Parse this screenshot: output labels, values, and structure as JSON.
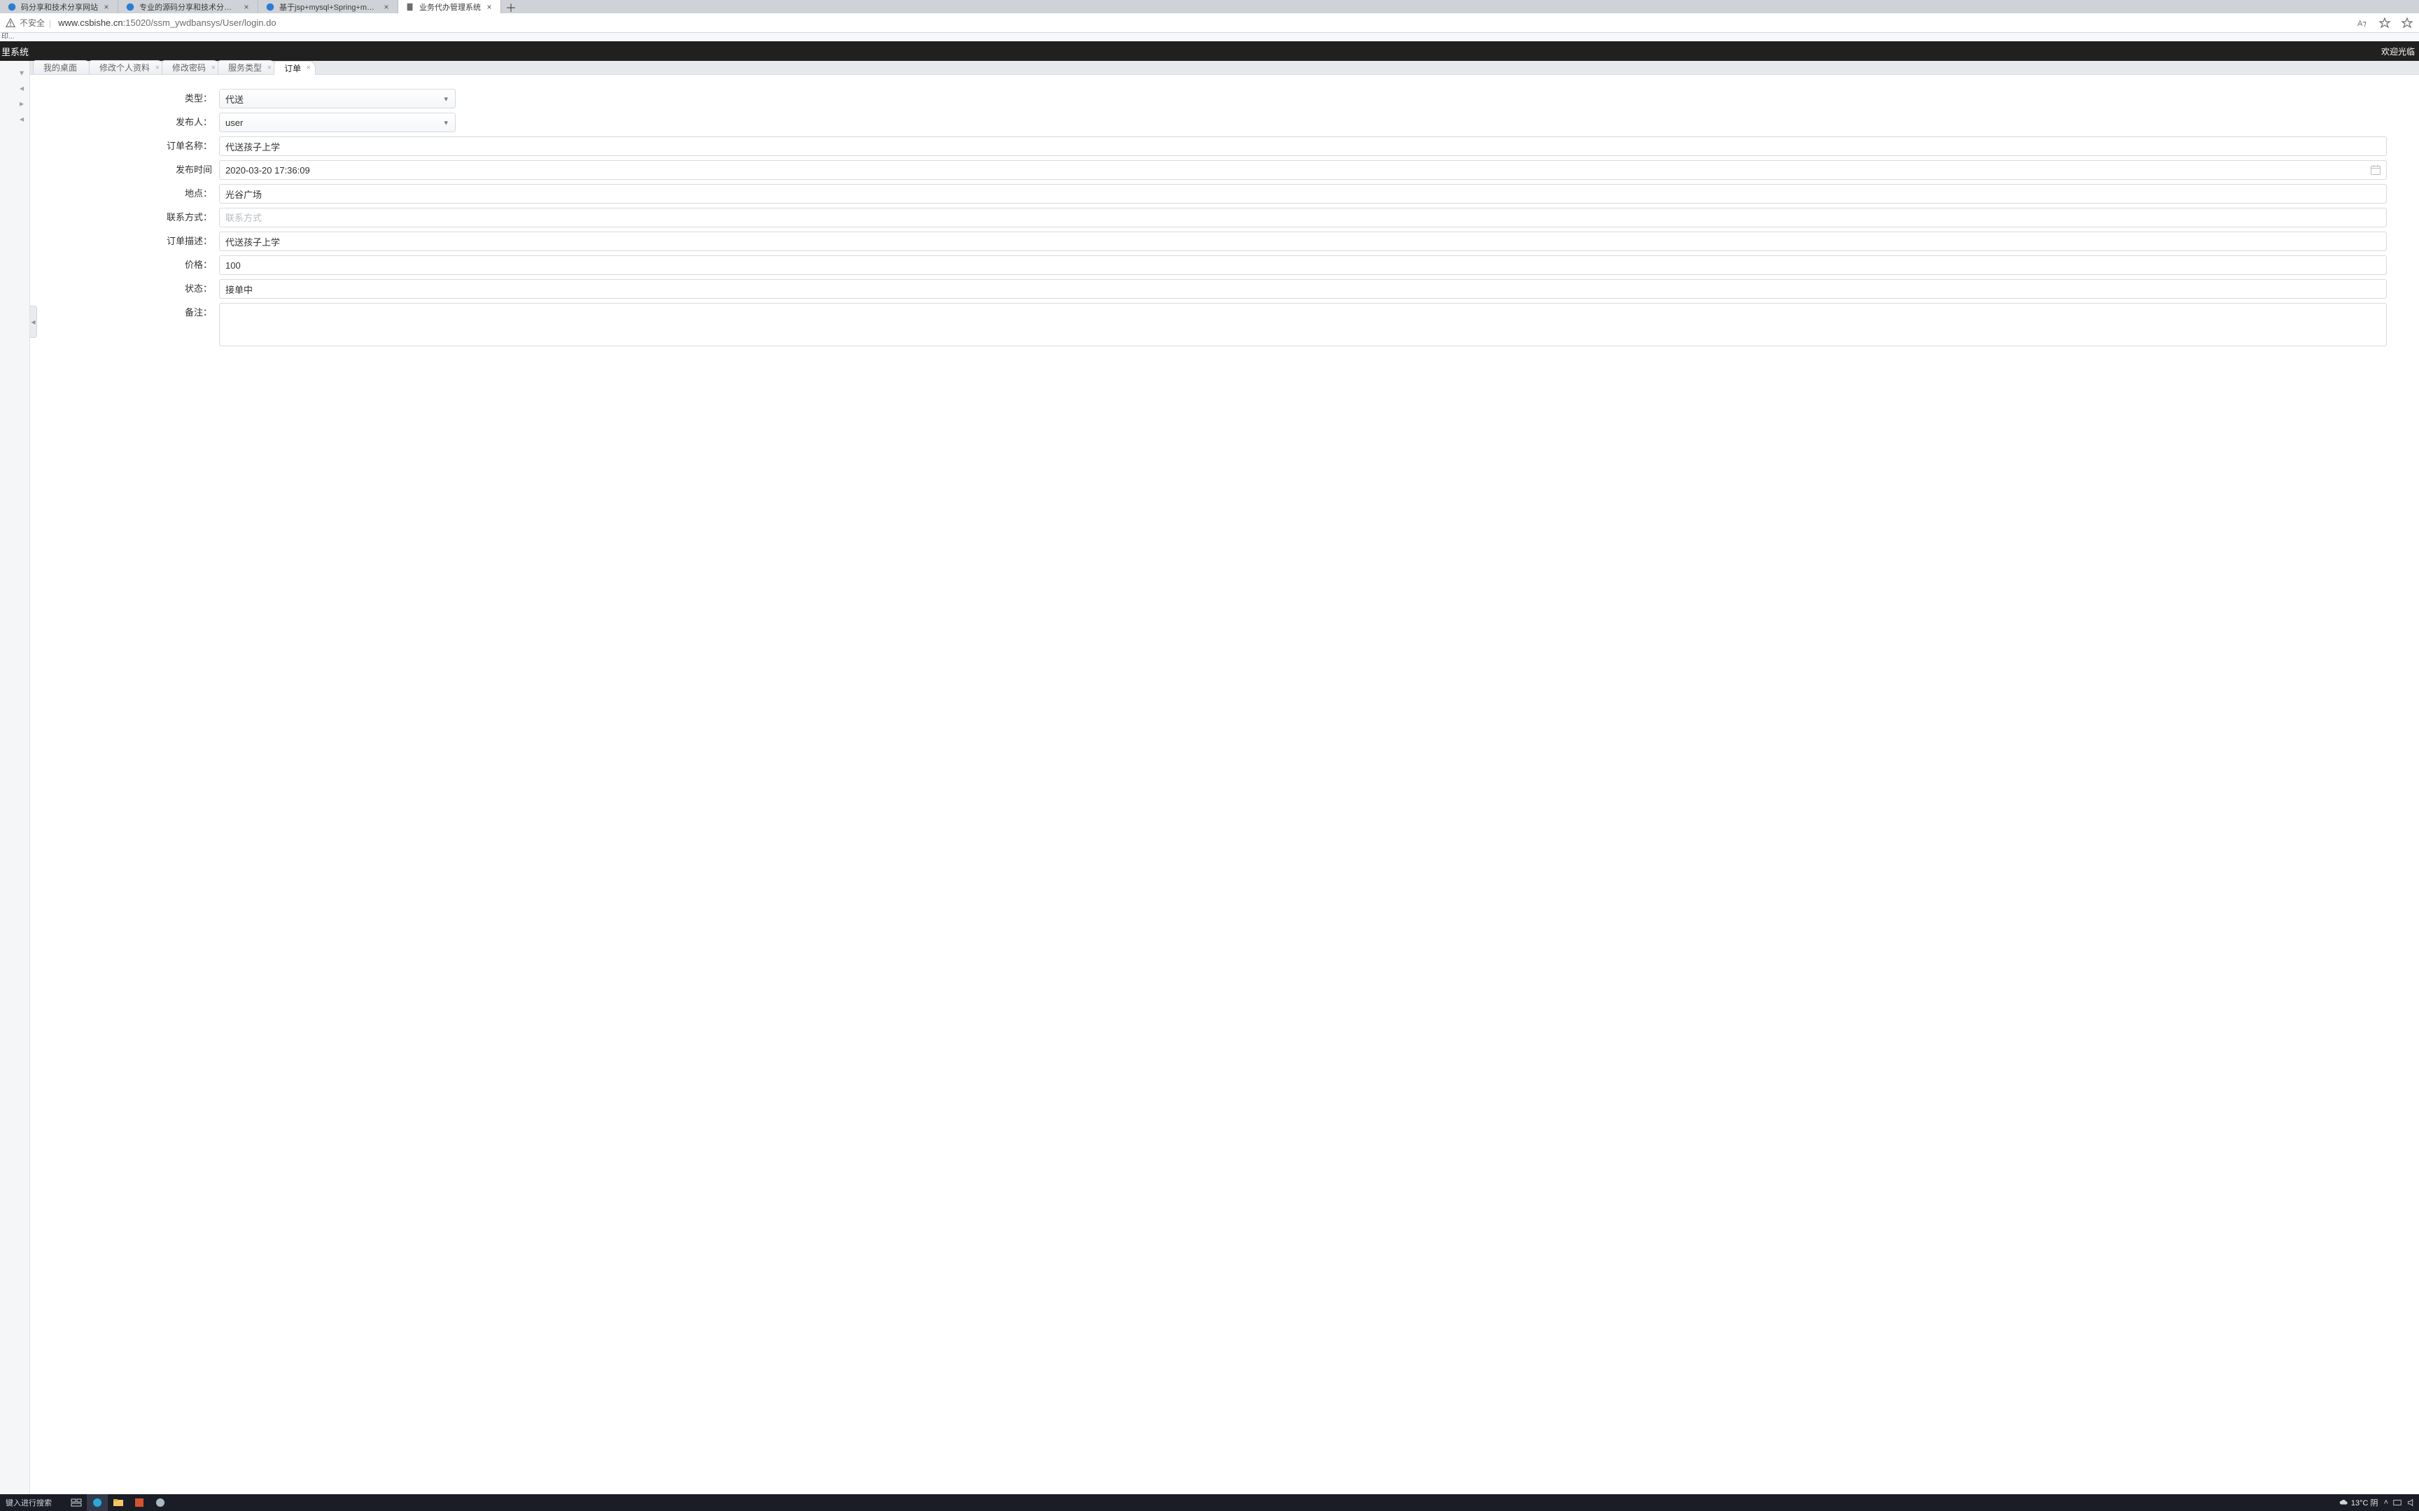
{
  "browser": {
    "tabs": [
      {
        "title": "码分享和技术分享网站",
        "favicon": "blue"
      },
      {
        "title": "专业的源码分享和技术分享网站",
        "favicon": "blue"
      },
      {
        "title": "基于jsp+mysql+Spring+mybati",
        "favicon": "blue"
      },
      {
        "title": "业务代办管理系统",
        "favicon": "doc",
        "active": true
      }
    ],
    "unsafe_label": "不安全",
    "url_host": "www.csbishe.cn",
    "url_rest": ":15020/ssm_ywdbansys/User/login.do",
    "mini_strip": "印..."
  },
  "app": {
    "brand": "里系统",
    "welcome": "欢迎光临"
  },
  "page_tabs": [
    {
      "label": "我的桌面"
    },
    {
      "label": "修改个人资料"
    },
    {
      "label": "修改密码"
    },
    {
      "label": "服务类型"
    },
    {
      "label": "订单",
      "active": true
    }
  ],
  "form": {
    "labels": {
      "type": "类型：",
      "publisher": "发布人：",
      "order_name": "订单名称：",
      "publish_time": "发布时间",
      "location": "地点：",
      "contact": "联系方式：",
      "order_desc": "订单描述：",
      "price": "价格：",
      "status": "状态：",
      "remark": "备注："
    },
    "values": {
      "type": "代送",
      "publisher": "user",
      "order_name": "代送孩子上学",
      "publish_time": "2020-03-20 17:36:09",
      "location": "光谷广场",
      "contact": "",
      "order_desc": "代送孩子上学",
      "price": "100",
      "status": "接单中",
      "remark": ""
    },
    "placeholders": {
      "contact": "联系方式"
    }
  },
  "taskbar": {
    "search_placeholder": "键入进行搜索",
    "weather_text": "13°C 阴"
  },
  "aria": {
    "chevron_down": "▾",
    "chevron_left": "◂",
    "chevron_right": "▸",
    "close_glyph": "×",
    "plus_glyph": "＋"
  }
}
